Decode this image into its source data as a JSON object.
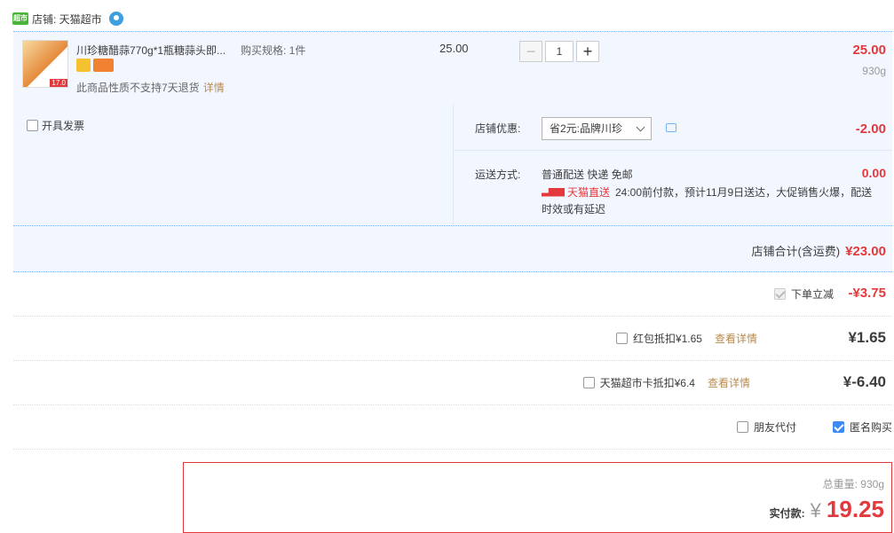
{
  "shop": {
    "label": "店铺: 天猫超市",
    "logo": "tmall-logo"
  },
  "item": {
    "title": "川珍糖醋蒜770g*1瓶糖蒜头即...",
    "spec": "购买规格: 1件",
    "thumb_price": "17.0",
    "no_return": "此商品性质不支持7天退货",
    "detail_link": "详情",
    "unit_price": "25.00",
    "quantity": "1",
    "total": "25.00",
    "weight": "930g"
  },
  "options": {
    "invoice_label": "开具发票",
    "shop_promo_label": "店铺优惠:",
    "shop_promo_value": "省2元:品牌川珍",
    "shop_promo_amount": "-2.00",
    "shipping_label": "运送方式:",
    "shipping_method": "普通配送 快递 免邮",
    "tmall_direct": "天猫直送",
    "shipping_note": "24:00前付款，预计11月9日送达，大促销售火爆，配送",
    "shipping_note2": "时效或有延迟",
    "shipping_amount": "0.00"
  },
  "shop_total": {
    "label": "店铺合计(含运费)",
    "amount": "¥23.00"
  },
  "discounts": {
    "instant_label": "下单立减",
    "instant_amount": "-¥3.75",
    "redpacket_label": "红包抵扣¥1.65",
    "redpacket_link": "查看详情",
    "redpacket_amount": "¥1.65",
    "card_label": "天猫超市卡抵扣¥6.4",
    "card_link": "查看详情",
    "card_amount": "¥-6.40",
    "friend_pay": "朋友代付",
    "anonymous": "匿名购买"
  },
  "payment": {
    "weight_total": "总重量: 930g",
    "actual_label": "实付款:",
    "currency": "¥",
    "actual_price": "19.25"
  },
  "colors": {
    "accent": "#e4393c",
    "panel": "#f2f7ff",
    "checkbox": "#3d8af7"
  }
}
